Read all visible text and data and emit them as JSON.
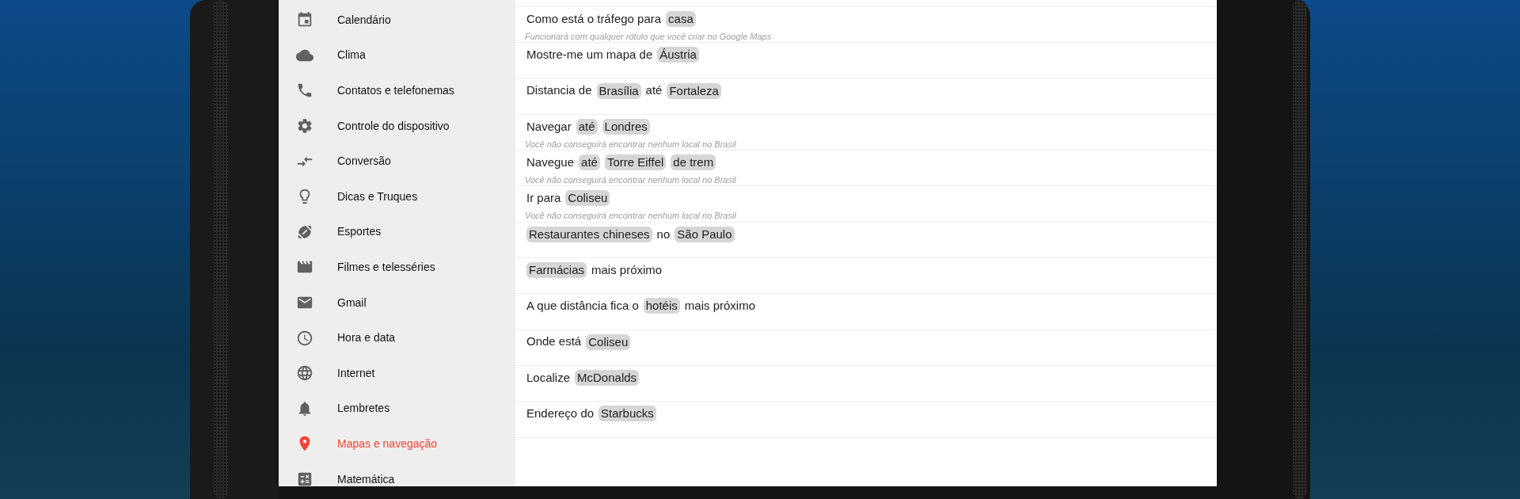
{
  "sidebar": {
    "items": [
      {
        "label": "Calendário",
        "selected": false
      },
      {
        "label": "Clima",
        "selected": false
      },
      {
        "label": "Contatos e telefonemas",
        "selected": false
      },
      {
        "label": "Controle do dispositivo",
        "selected": false
      },
      {
        "label": "Conversão",
        "selected": false
      },
      {
        "label": "Dicas e Truques",
        "selected": false
      },
      {
        "label": "Esportes",
        "selected": false
      },
      {
        "label": "Filmes e telesséries",
        "selected": false
      },
      {
        "label": "Gmail",
        "selected": false
      },
      {
        "label": "Hora e data",
        "selected": false
      },
      {
        "label": "Internet",
        "selected": false
      },
      {
        "label": "Lembretes",
        "selected": false
      },
      {
        "label": "Mapas e navegação",
        "selected": true
      },
      {
        "label": "Matemática",
        "selected": false
      }
    ]
  },
  "queries": [
    {
      "parts": [
        {
          "kind": "plain",
          "text": "Como está o tráfego para"
        },
        {
          "kind": "slot",
          "text": "casa"
        }
      ],
      "hint": "Funcionará com qualquer rótulo que você criar no Google Maps"
    },
    {
      "parts": [
        {
          "kind": "plain",
          "text": "Mostre-me um mapa de"
        },
        {
          "kind": "slot",
          "text": "Áustria"
        }
      ]
    },
    {
      "parts": [
        {
          "kind": "plain",
          "text": "Distancia de"
        },
        {
          "kind": "slot",
          "text": "Brasília"
        },
        {
          "kind": "plain",
          "text": "até"
        },
        {
          "kind": "slot",
          "text": "Fortaleza"
        }
      ]
    },
    {
      "parts": [
        {
          "kind": "plain",
          "text": "Navegar"
        },
        {
          "kind": "slot",
          "text": "até"
        },
        {
          "kind": "slot",
          "text": "Londres"
        }
      ],
      "hint": "Você não conseguirá encontrar nenhum local no Brasil"
    },
    {
      "parts": [
        {
          "kind": "plain",
          "text": "Navegue"
        },
        {
          "kind": "slot",
          "text": "até"
        },
        {
          "kind": "slot",
          "text": "Torre Eiffel"
        },
        {
          "kind": "slot",
          "text": "de trem"
        }
      ],
      "hint": "Você não conseguirá encontrar nenhum local no Brasil"
    },
    {
      "parts": [
        {
          "kind": "plain",
          "text": "Ir para"
        },
        {
          "kind": "slot",
          "text": "Coliseu"
        }
      ],
      "hint": "Você não conseguirá encontrar nenhum local no Brasil"
    },
    {
      "parts": [
        {
          "kind": "slot",
          "text": "Restaurantes chineses"
        },
        {
          "kind": "plain",
          "text": "no"
        },
        {
          "kind": "slot",
          "text": "São Paulo"
        }
      ]
    },
    {
      "parts": [
        {
          "kind": "slot",
          "text": "Farmácias"
        },
        {
          "kind": "plain",
          "text": "mais próximo"
        }
      ]
    },
    {
      "parts": [
        {
          "kind": "plain",
          "text": "A que distância fica o"
        },
        {
          "kind": "slot",
          "text": "hotéis"
        },
        {
          "kind": "plain",
          "text": "mais próximo"
        }
      ]
    },
    {
      "parts": [
        {
          "kind": "plain",
          "text": "Onde está"
        },
        {
          "kind": "slot",
          "text": "Coliseu"
        }
      ]
    },
    {
      "parts": [
        {
          "kind": "plain",
          "text": "Localize"
        },
        {
          "kind": "slot",
          "text": "McDonalds"
        }
      ]
    },
    {
      "parts": [
        {
          "kind": "plain",
          "text": "Endereço do"
        },
        {
          "kind": "slot",
          "text": "Starbucks"
        }
      ]
    }
  ]
}
